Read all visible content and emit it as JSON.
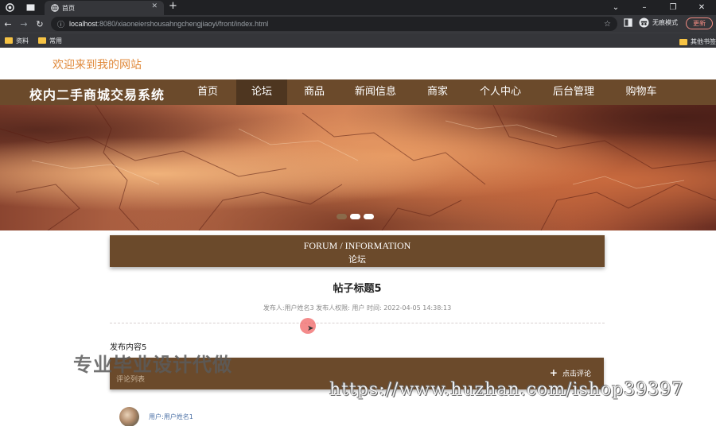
{
  "browser": {
    "tab_title": "首页",
    "url_host": "localhost",
    "url_path": ":8080/xiaoneiershousahngchengjiaoyi/front/index.html",
    "incognito_label": "无痕模式",
    "update_label": "更新",
    "bookmarks": [
      "资料",
      "常用"
    ],
    "bookmarks_right": "其他书签"
  },
  "header": {
    "welcome": "欢迎来到我的网站",
    "site_name": "校内二手商城交易系统"
  },
  "nav": {
    "items": [
      "首页",
      "论坛",
      "商品",
      "新闻信息",
      "商家",
      "个人中心",
      "后台管理",
      "购物车"
    ],
    "active_index": 1
  },
  "banner": {
    "slides": 3,
    "active_slide": 0
  },
  "forum": {
    "heading_en": "FORUM / INFORMATION",
    "heading_cn": "论坛"
  },
  "post": {
    "title": "帖子标题5",
    "meta": "发布人:用户姓名3   发布人权限: 用户   时间: 2022-04-05 14:38:13",
    "content": "发布内容5"
  },
  "comments": {
    "list_label": "评论列表",
    "add_label": "点击评论",
    "user_prefix": "用户:",
    "user_name": "用户姓名1"
  },
  "watermarks": {
    "cn": "专业毕业设计代做",
    "url": "https://www.huzhan.com/ishop39397"
  },
  "colors": {
    "brand_brown": "#6b4a2b",
    "welcome_orange": "#e08a3c"
  }
}
